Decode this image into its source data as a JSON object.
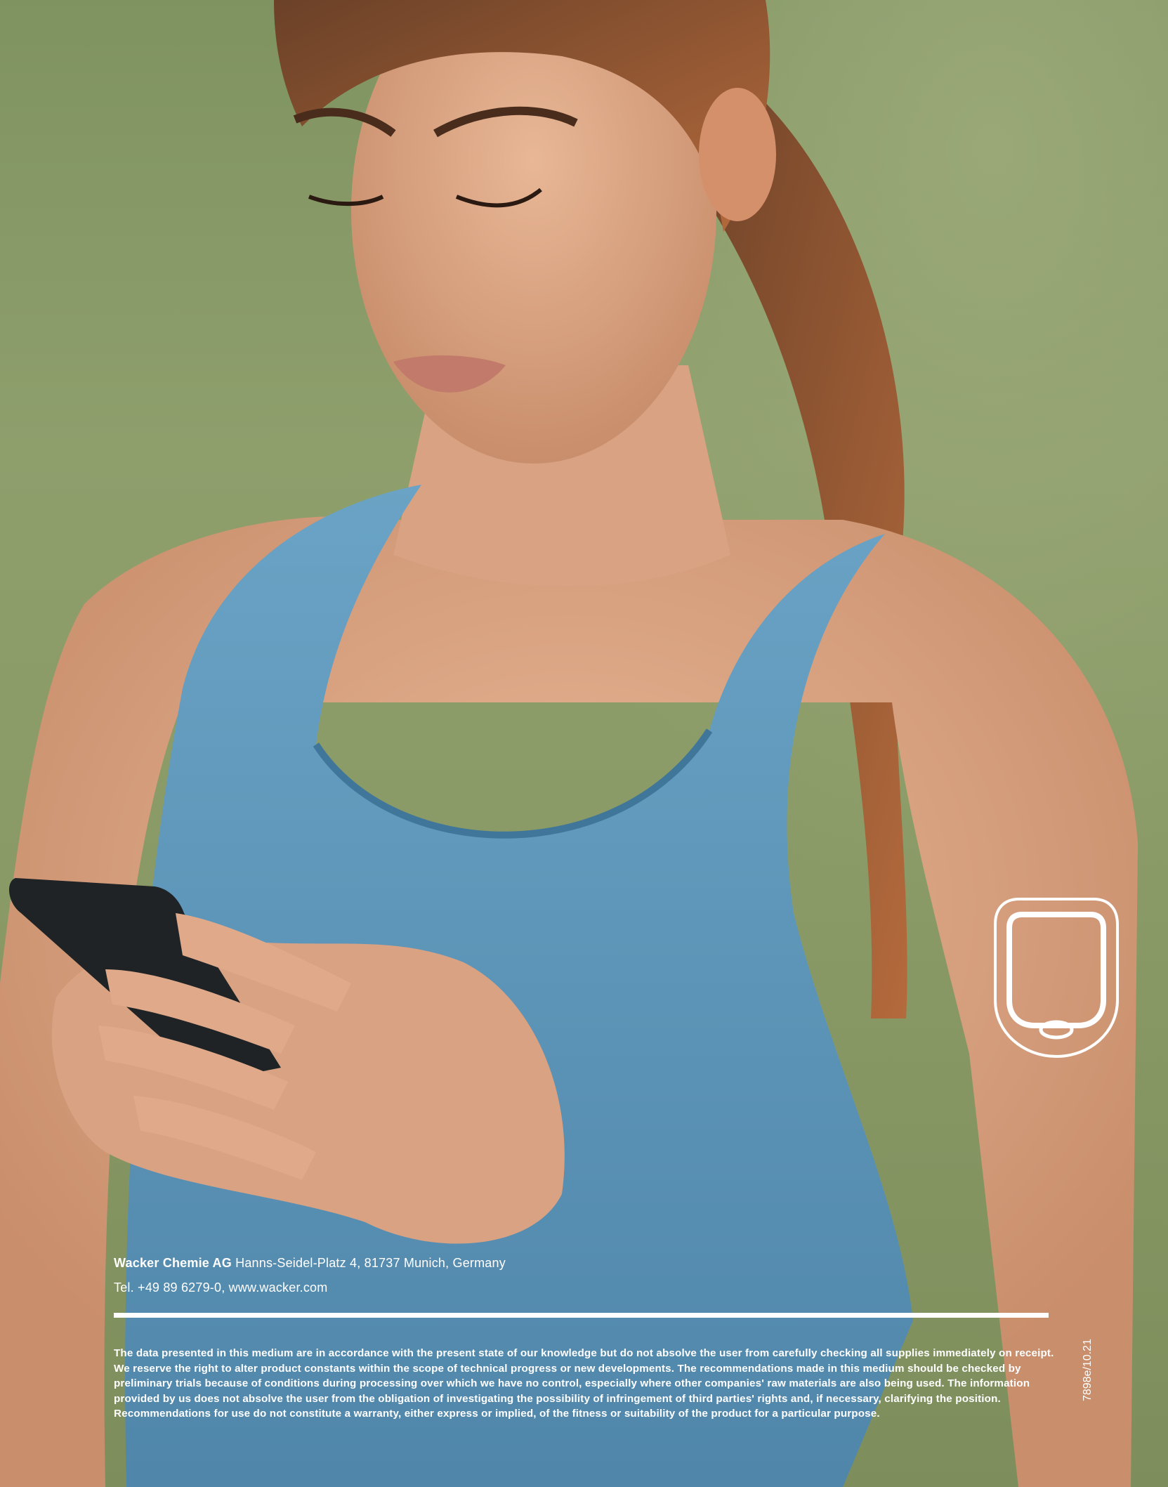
{
  "photo": {
    "subject": "woman-using-smartphone",
    "colors": {
      "background": "#8a9a66",
      "top": "#5a8fb0",
      "skin": "#d9a585",
      "hair": "#7a4a2a"
    }
  },
  "sensor_icon": {
    "icon": "glucose-sensor-outline-icon",
    "color": "#ffffff"
  },
  "footer": {
    "company": "Wacker Chemie AG",
    "address": "Hanns-Seidel-Platz 4, 81737 Munich, Germany",
    "contact": "Tel. +49 89 6279-0, www.wacker.com",
    "disclaimer": "The data presented in this medium are in accordance with the present state of our knowledge but do not absolve the user from carefully checking all supplies immediately on receipt. We reserve the right to alter product constants within the scope of technical progress or new developments. The recommendations made in this medium should be checked by preliminary trials because of conditions during processing over which we have no control, especially where other companies' raw materials are also being used. The information provided by us does not absolve the user from the obligation of investigating the possibility of infringement of third parties' rights and, if necessary, clarifying the position. Recommendations for use do not constitute a warranty, either express or implied, of the fitness or suitability of the product for a particular purpose.",
    "doc_code": "7898e/10.21"
  }
}
